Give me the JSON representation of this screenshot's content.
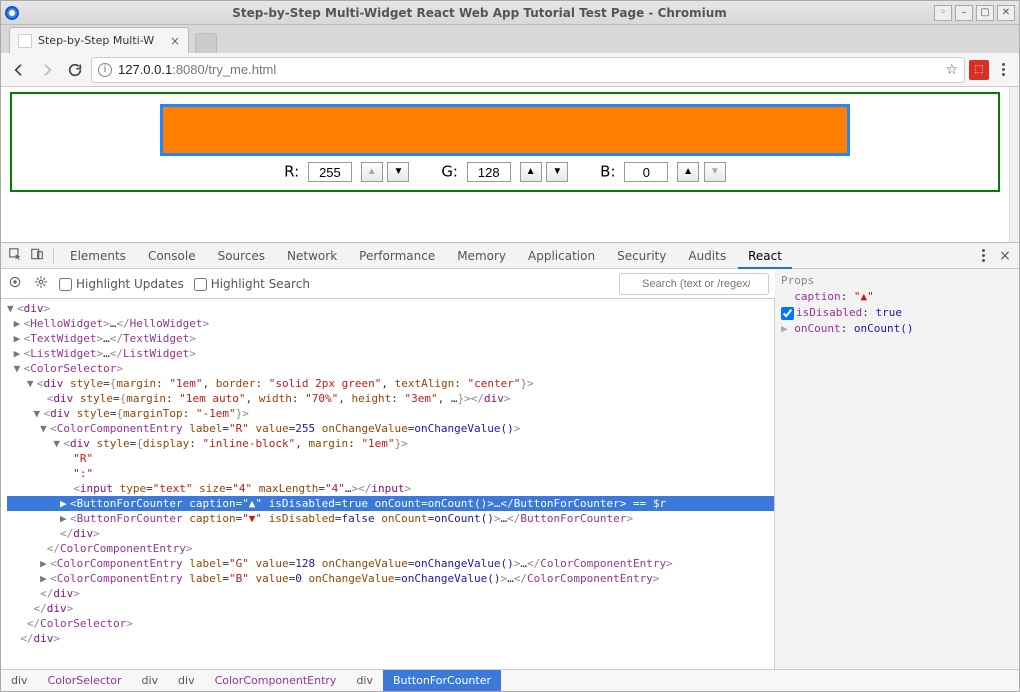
{
  "window": {
    "title": "Step-by-Step Multi-Widget React Web App Tutorial Test Page - Chromium",
    "tab_label": "Step-by-Step Multi-W",
    "url_info_glyph": "ⓘ",
    "url_host": "127.0.0.1",
    "url_port": ":8080",
    "url_path": "/try_me.html"
  },
  "nav": {
    "back": "←",
    "forward": "→",
    "reload": "⟳",
    "star": "☆",
    "menu": "⋮"
  },
  "page": {
    "rgb": {
      "r_label": "R:",
      "g_label": "G:",
      "b_label": "B:",
      "r_value": "255",
      "g_value": "128",
      "b_value": "0",
      "up": "▲",
      "down": "▼"
    },
    "swatch_color": "#ff8000",
    "swatch_border": "#1e88ff"
  },
  "devtools": {
    "tabs": [
      "Elements",
      "Console",
      "Sources",
      "Network",
      "Performance",
      "Memory",
      "Application",
      "Security",
      "Audits",
      "React"
    ],
    "active_tab": "React",
    "react_toolbar": {
      "highlight_updates": "Highlight Updates",
      "highlight_search": "Highlight Search",
      "search_placeholder": "Search (text or /regex/)"
    },
    "props": {
      "header": "Props",
      "caption_key": "caption",
      "caption_val": "\"▲\"",
      "isDisabled_key": "isDisabled",
      "isDisabled_val": "true",
      "onCount_key": "onCount",
      "onCount_val": "onCount()"
    },
    "tree_plain": {
      "l01": "▼<div>",
      "l02": " ▶<HelloWidget>…</HelloWidget>",
      "l03": " ▶<TextWidget>…</TextWidget>",
      "l04": " ▶<ListWidget>…</ListWidget>",
      "l05": " ▼<ColorSelector>",
      "l06": "   ▼<div style={margin: \"1em\", border: \"solid 2px green\", textAlign: \"center\"}>",
      "l07": "      <div style={margin: \"1em auto\", width: \"70%\", height: \"3em\", …}></div>",
      "l08": "    ▼<div style={marginTop: \"-1em\"}>",
      "l09": "     ▼<ColorComponentEntry label=\"R\" value=255 onChangeValue=onChangeValue()>",
      "l10": "       ▼<div style={display: \"inline-block\", margin: \"1em\"}>",
      "l11": "          \"R\"",
      "l12": "          \":\"",
      "l13": "          <input type=\"text\" size=\"4\" maxLength=\"4\"…></input>",
      "l14": "        ▶<ButtonForCounter caption=\"▲\" isDisabled=true onCount=onCount()>…</ButtonForCounter> == $r",
      "l15": "        ▶<ButtonForCounter caption=\"▼\" isDisabled=false onCount=onCount()>…</ButtonForCounter>",
      "l16": "        </div>",
      "l17": "      </ColorComponentEntry>",
      "l18": "     ▶<ColorComponentEntry label=\"G\" value=128 onChangeValue=onChangeValue()>…</ColorComponentEntry>",
      "l19": "     ▶<ColorComponentEntry label=\"B\" value=0 onChangeValue=onChangeValue()>…</ColorComponentEntry>",
      "l20": "     </div>",
      "l21": "    </div>",
      "l22": "   </ColorSelector>",
      "l23": "  </div>"
    },
    "breadcrumb": [
      "div",
      "ColorSelector",
      "div",
      "div",
      "ColorComponentEntry",
      "div",
      "ButtonForCounter"
    ]
  }
}
